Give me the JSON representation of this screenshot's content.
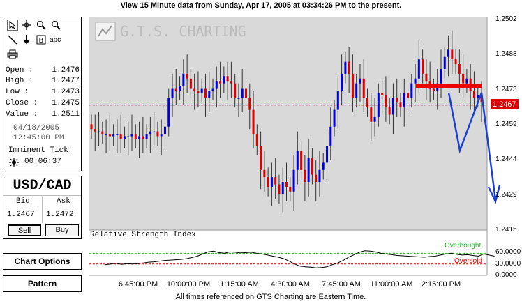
{
  "header": {
    "title": "View 15 Minute  data from Sunday, Apr 17, 2005 at 03:34:26 PM to the present."
  },
  "footer": {
    "text": "All times referenced on GTS Charting are Eastern Time."
  },
  "toolbar": {
    "tools": [
      {
        "icon": "pointer-arrow-icon"
      },
      {
        "icon": "crosshair-icon"
      },
      {
        "icon": "zoom-in-icon"
      },
      {
        "icon": "zoom-out-icon"
      },
      {
        "icon": "line-draw-icon"
      },
      {
        "icon": "down-arrow-icon"
      },
      {
        "icon": "text-box-icon"
      },
      {
        "icon": "text-tool-icon",
        "label": "abc"
      },
      {
        "icon": "printer-icon"
      }
    ]
  },
  "quote": {
    "open_label": "Open :",
    "open": "1.2476",
    "high_label": "High :",
    "high": "1.2477",
    "low_label": "Low :",
    "low": "1.2473",
    "close_label": "Close :",
    "close": "1.2475",
    "value_label": "Value :",
    "value": "1.2511",
    "date": "04/18/2005",
    "time": "12:45:00 PM",
    "imminent_label": "Imminent Tick",
    "imminent_time": "00:06:37"
  },
  "pair": {
    "symbol": "USD/CAD",
    "bid_label": "Bid",
    "ask_label": "Ask",
    "bid": "1.2467",
    "ask": "1.2472",
    "sell_label": "Sell",
    "buy_label": "Buy"
  },
  "buttons": {
    "chart_options": "Chart Options",
    "pattern": "Pattern"
  },
  "chart_data": [
    {
      "type": "candlestick",
      "title": "",
      "watermark": "G.T.S. CHARTING",
      "y_ticks": [
        "1.2502",
        "1.2488",
        "1.2473",
        "1.2459",
        "1.2444",
        "1.2429",
        "1.2415"
      ],
      "ylim": [
        1.2415,
        1.2502
      ],
      "x_ticks": [
        "6:45:00 PM",
        "10:00:00 PM",
        "1:15:00 AM",
        "4:30:00 AM",
        "7:45:00 AM",
        "11:00:00 AM",
        "2:15:00 PM"
      ],
      "current_price_label": "1.2467",
      "current_price": 1.2467,
      "colors": {
        "up": "#0000dd",
        "down": "#dd0000",
        "background": "#d9d9d9",
        "price_line": "#dd0000",
        "annotation": "#1a3fd0"
      },
      "closes": [
        1.2457,
        1.2456,
        1.2456,
        1.2455,
        1.2455,
        1.2454,
        1.2455,
        1.2455,
        1.2453,
        1.2454,
        1.2454,
        1.2455,
        1.2453,
        1.2454,
        1.2453,
        1.2455,
        1.2456,
        1.2456,
        1.2454,
        1.2455,
        1.2458,
        1.247,
        1.2474,
        1.2473,
        1.2475,
        1.248,
        1.2478,
        1.2474,
        1.2473,
        1.2472,
        1.2474,
        1.247,
        1.2473,
        1.2474,
        1.2477,
        1.2476,
        1.2479,
        1.2477,
        1.2476,
        1.247,
        1.247,
        1.2474,
        1.247,
        1.2465,
        1.2455,
        1.245,
        1.244,
        1.2437,
        1.2433,
        1.2437,
        1.2434,
        1.243,
        1.2435,
        1.2433,
        1.2431,
        1.244,
        1.2448,
        1.244,
        1.2435,
        1.2445,
        1.2438,
        1.2435,
        1.244,
        1.2443,
        1.245,
        1.2458,
        1.2465,
        1.2473,
        1.248,
        1.2485,
        1.248,
        1.247,
        1.2476,
        1.2478,
        1.247,
        1.2466,
        1.246,
        1.2462,
        1.2472,
        1.2471,
        1.2466,
        1.2463,
        1.247,
        1.2468,
        1.2466,
        1.2472,
        1.247,
        1.2476,
        1.2478,
        1.2486,
        1.248,
        1.2477,
        1.2474,
        1.2473,
        1.2476,
        1.2482,
        1.2487,
        1.249,
        1.2486,
        1.2484,
        1.248,
        1.2476,
        1.2478,
        1.2473,
        1.247,
        1.2471,
        1.2468
      ],
      "annotation": {
        "type": "arrow-path",
        "description": "horizontal red resistance bar and blue zigzag arrow pointing down"
      }
    },
    {
      "type": "line",
      "title": "Relative Strength Index",
      "overbought_label": "Overbought",
      "oversold_label": "Oversold",
      "y_ticks": [
        "60.0000",
        "30.0000",
        "0.0000"
      ],
      "overbought": 60,
      "oversold": 30,
      "ylim": [
        0,
        100
      ],
      "values": [
        28,
        30,
        32,
        29,
        31,
        30,
        31,
        33,
        35,
        36,
        38,
        40,
        41,
        42,
        43,
        45,
        48,
        52,
        58,
        64,
        66,
        62,
        60,
        64,
        63,
        61,
        62,
        63,
        60,
        58,
        55,
        52,
        49,
        45,
        38,
        30,
        24,
        22,
        21,
        19,
        20,
        22,
        28,
        33,
        40,
        49,
        56,
        63,
        67,
        66,
        64,
        60,
        58,
        56,
        54,
        53,
        52,
        51,
        50,
        49,
        51,
        52,
        55,
        58,
        60,
        57,
        55,
        56,
        54,
        52,
        58,
        55,
        52
      ]
    }
  ]
}
